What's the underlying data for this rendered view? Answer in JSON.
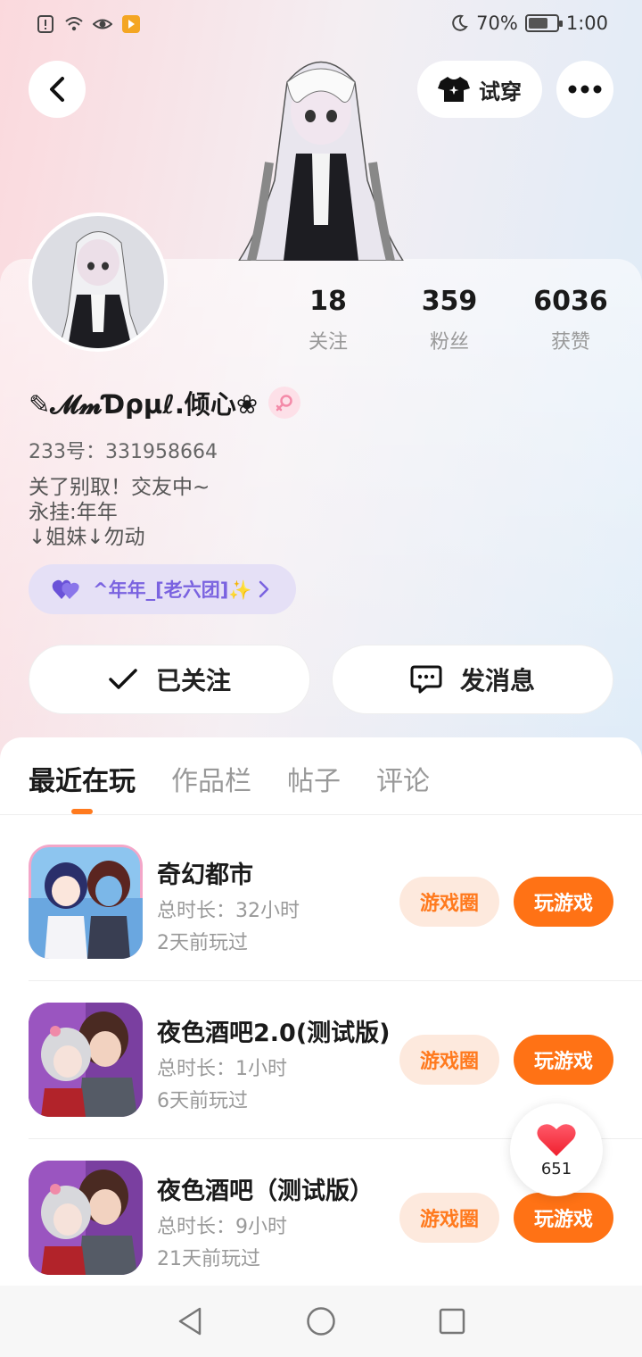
{
  "status_bar": {
    "battery": "70%",
    "battery_level": 0.7,
    "time": "1:00"
  },
  "header": {
    "try_on_label": "试穿"
  },
  "profile": {
    "stats": [
      {
        "value": "18",
        "label": "关注"
      },
      {
        "value": "359",
        "label": "粉丝"
      },
      {
        "value": "6036",
        "label": "获赞"
      }
    ],
    "username": "✎𝓜𝓶Ɗρµℓ.倾心❀",
    "uid": "233号：331958664",
    "bio_lines": [
      "关了别取！交友中~",
      "永挂:年年",
      "↓姐妹↓勿动"
    ],
    "group_name": "^年年_[老六团]✨",
    "follow_label": "已关注",
    "message_label": "发消息"
  },
  "tabs": [
    {
      "label": "最近在玩",
      "active": true
    },
    {
      "label": "作品栏",
      "active": false
    },
    {
      "label": "帖子",
      "active": false
    },
    {
      "label": "评论",
      "active": false
    }
  ],
  "games": [
    {
      "title": "奇幻都市",
      "duration": "总时长：32小时",
      "last_played": "2天前玩过",
      "circle_label": "游戏圈",
      "play_label": "玩游戏"
    },
    {
      "title": "夜色酒吧2.0(测试版)",
      "duration": "总时长：1小时",
      "last_played": "6天前玩过",
      "circle_label": "游戏圈",
      "play_label": "玩游戏"
    },
    {
      "title": "夜色酒吧（测试版）",
      "duration": "总时长：9小时",
      "last_played": "21天前玩过",
      "circle_label": "游戏圈",
      "play_label": "玩游戏"
    }
  ],
  "like_float": {
    "count": "651"
  },
  "colors": {
    "accent": "#ff7215",
    "accent_soft": "#fde9dd",
    "group_text": "#7a63e0",
    "group_bg": "#e5e0f6"
  }
}
